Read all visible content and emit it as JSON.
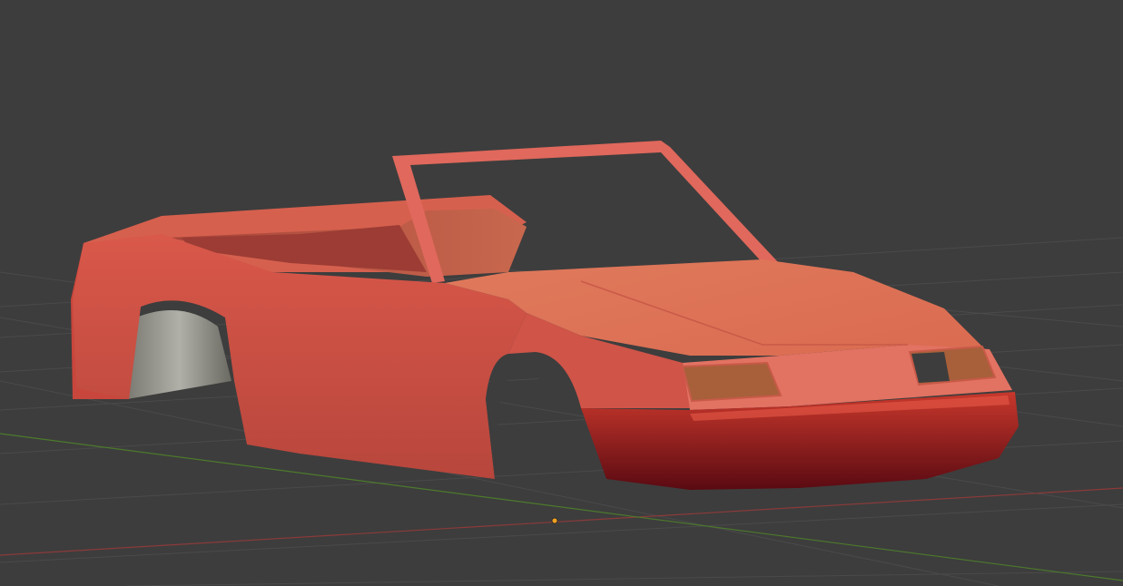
{
  "viewport": {
    "kind": "3d-viewport",
    "background_color": "#3d3d3d",
    "grid_line_color": "#4a4a4a",
    "x_axis_color": "#8c3a3a",
    "y_axis_color": "#4c7a2c",
    "origin_marker_color": "#f0a020"
  },
  "scene": {
    "objects": [
      {
        "name": "convertible-car-body",
        "base_color": "#d9584a",
        "highlight_color": "#e8776a",
        "shadow_color": "#8a1c1a",
        "interior_color": "#b04a3e",
        "headlight_color": "#a8603a",
        "underside_color": "#9a9a9a"
      }
    ]
  }
}
